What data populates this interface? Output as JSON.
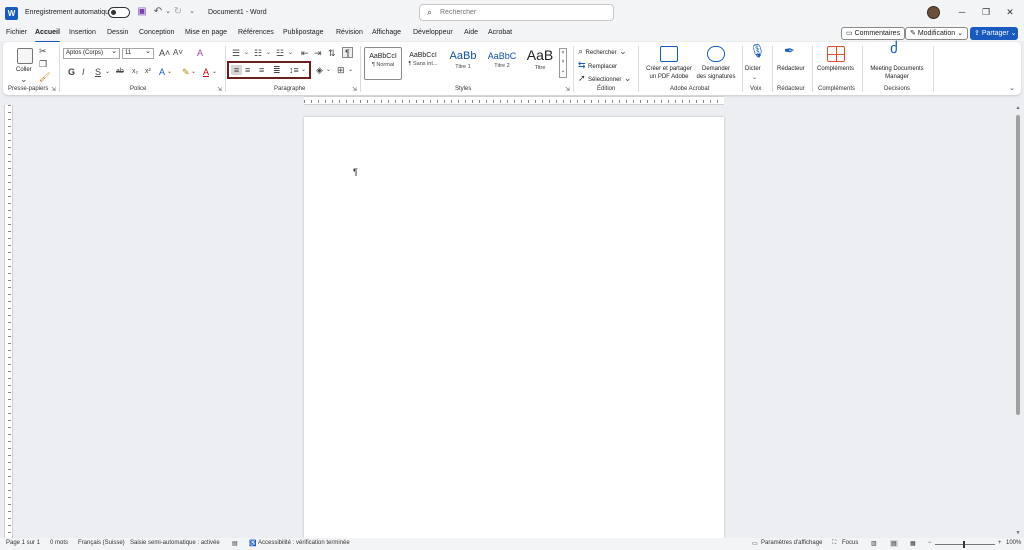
{
  "titlebar": {
    "autosave_label": "Enregistrement automatique",
    "document_title": "Document1 - Word",
    "search_placeholder": "Rechercher",
    "logo_letter": "W",
    "icons": {
      "save": "save-icon",
      "undo": "undo-icon",
      "redo": "redo-icon"
    }
  },
  "menu": {
    "tabs": [
      "Fichier",
      "Accueil",
      "Insertion",
      "Dessin",
      "Conception",
      "Mise en page",
      "Références",
      "Publipostage",
      "Révision",
      "Affichage",
      "Développeur",
      "Aide",
      "Acrobat"
    ],
    "active_tab": "Accueil",
    "comments_label": "Commentaires",
    "editing_label": "Modification",
    "share_label": "Partager"
  },
  "ribbon": {
    "clipboard": {
      "paste": "Coller",
      "group": "Presse-papiers"
    },
    "font": {
      "font_name": "Aptos (Corps)",
      "font_size": "11",
      "group": "Police",
      "bold": "G",
      "italic": "I",
      "underline": "S",
      "strike": "ab",
      "subscript": "x₂",
      "superscript": "x²",
      "effects": "A",
      "color": "A"
    },
    "paragraph": {
      "group": "Paragraphe"
    },
    "styles": {
      "group": "Styles",
      "items": [
        {
          "preview": "AaBbCcI",
          "name": "¶ Normal"
        },
        {
          "preview": "AaBbCcI",
          "name": "¶ Sans int..."
        },
        {
          "preview": "AaBb",
          "name": "Titre 1"
        },
        {
          "preview": "AaBbC",
          "name": "Titre 2"
        },
        {
          "preview": "AaB",
          "name": "Titre"
        }
      ]
    },
    "editing": {
      "find": "Rechercher",
      "replace": "Remplacer",
      "select": "Sélectionner",
      "group": "Édition"
    },
    "acrobat": {
      "create": "Créer et partager",
      "create2": "un PDF Adobe",
      "sign": "Demander",
      "sign2": "des signatures",
      "group": "Adobe Acrobat"
    },
    "voice": {
      "dictate": "Dicter",
      "group": "Voix"
    },
    "editor": {
      "label": "Rédacteur",
      "group": "Rédacteur"
    },
    "addins": {
      "label": "Compléments",
      "group": "Compléments"
    },
    "meeting": {
      "label1": "Meeting Documents",
      "label2": "Manager",
      "group": "Decisions"
    }
  },
  "document": {
    "pilcrow": "¶"
  },
  "status": {
    "page": "Page 1 sur 1",
    "words": "0 mots",
    "language": "Français (Suisse)",
    "predictive": "Saisie semi-automatique : activée",
    "accessibility": "Accessibilité : vérification terminée",
    "display_settings": "Paramètres d'affichage",
    "focus": "Focus",
    "zoom": "100%",
    "zoom_minus": "−",
    "zoom_plus": "+"
  },
  "colors": {
    "accent": "#185abd",
    "highlight_box": "#6b1e1e",
    "acrobat_red": "#e34a2f"
  }
}
